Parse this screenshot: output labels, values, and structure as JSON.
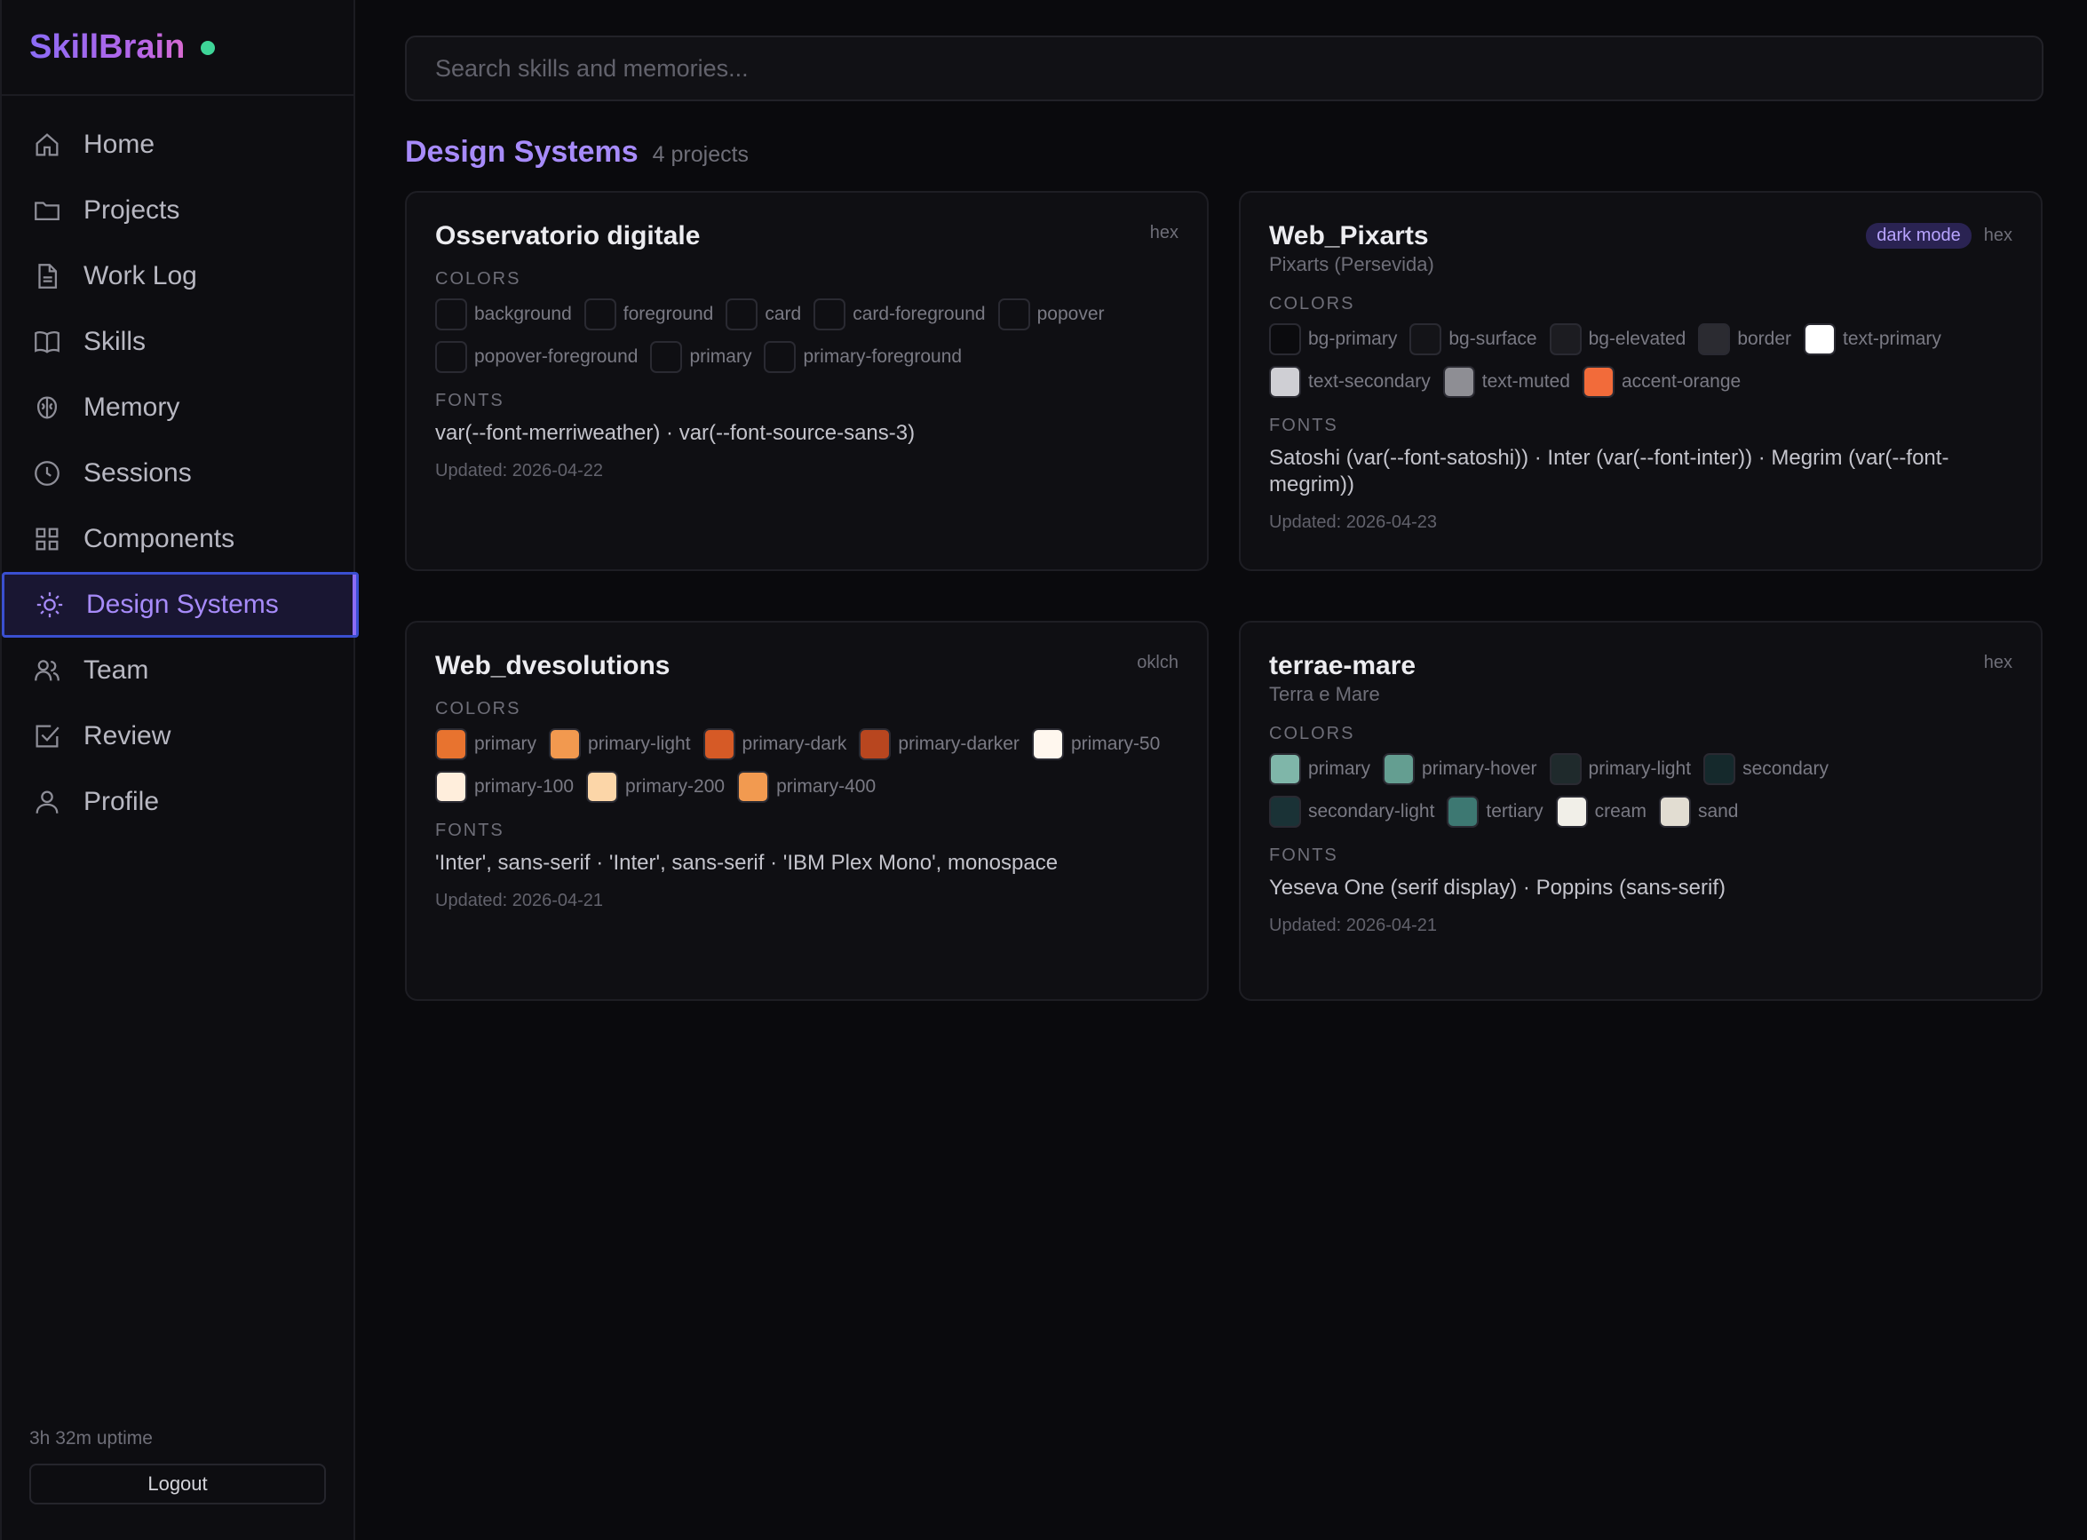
{
  "app": {
    "name": "SkillBrain"
  },
  "sidebar": {
    "items": [
      {
        "label": "Home",
        "icon": "home-icon"
      },
      {
        "label": "Projects",
        "icon": "folder-icon"
      },
      {
        "label": "Work Log",
        "icon": "document-icon"
      },
      {
        "label": "Skills",
        "icon": "book-icon"
      },
      {
        "label": "Memory",
        "icon": "brain-icon"
      },
      {
        "label": "Sessions",
        "icon": "clock-icon"
      },
      {
        "label": "Components",
        "icon": "grid-icon"
      },
      {
        "label": "Design Systems",
        "icon": "sun-icon",
        "active": true
      },
      {
        "label": "Team",
        "icon": "users-icon"
      },
      {
        "label": "Review",
        "icon": "check-square-icon"
      },
      {
        "label": "Profile",
        "icon": "user-icon"
      }
    ],
    "uptime": "3h 32m uptime",
    "logout_label": "Logout"
  },
  "search": {
    "placeholder": "Search skills and memories..."
  },
  "page": {
    "title": "Design Systems",
    "count": "4 projects"
  },
  "labels": {
    "colors": "COLORS",
    "fonts": "FONTS"
  },
  "cards": [
    {
      "title": "Osservatorio digitale",
      "subtitle": "",
      "dark_mode": "",
      "format": "hex",
      "colors": [
        {
          "name": "background",
          "hex": "#0f0f13"
        },
        {
          "name": "foreground",
          "hex": "#0f0f13"
        },
        {
          "name": "card",
          "hex": "#0f0f13"
        },
        {
          "name": "card-foreground",
          "hex": "#0f0f13"
        },
        {
          "name": "popover",
          "hex": "#0f0f13"
        },
        {
          "name": "popover-foreground",
          "hex": "#0f0f13"
        },
        {
          "name": "primary",
          "hex": "#0f0f13"
        },
        {
          "name": "primary-foreground",
          "hex": "#0f0f13"
        }
      ],
      "fonts": "var(--font-merriweather) · var(--font-source-sans-3)",
      "updated": "Updated: 2026-04-22"
    },
    {
      "title": "Web_Pixarts",
      "subtitle": "Pixarts (Persevida)",
      "dark_mode": "dark mode",
      "format": "hex",
      "colors": [
        {
          "name": "bg-primary",
          "hex": "#0b0b0e"
        },
        {
          "name": "bg-surface",
          "hex": "#141418"
        },
        {
          "name": "bg-elevated",
          "hex": "#1c1c21"
        },
        {
          "name": "border",
          "hex": "#2b2b31"
        },
        {
          "name": "text-primary",
          "hex": "#ffffff"
        },
        {
          "name": "text-secondary",
          "hex": "#cfcfd4"
        },
        {
          "name": "text-muted",
          "hex": "#8e8e94"
        },
        {
          "name": "accent-orange",
          "hex": "#f26b3a"
        }
      ],
      "fonts": "Satoshi (var(--font-satoshi)) · Inter (var(--font-inter)) · Megrim (var(--font-megrim))",
      "updated": "Updated: 2026-04-23"
    },
    {
      "title": "Web_dvesolutions",
      "subtitle": "",
      "dark_mode": "",
      "format": "oklch",
      "colors": [
        {
          "name": "primary",
          "hex": "#e8732f"
        },
        {
          "name": "primary-light",
          "hex": "#f2994f"
        },
        {
          "name": "primary-dark",
          "hex": "#d65a26"
        },
        {
          "name": "primary-darker",
          "hex": "#b8461f"
        },
        {
          "name": "primary-50",
          "hex": "#fff7ee"
        },
        {
          "name": "primary-100",
          "hex": "#ffeedc"
        },
        {
          "name": "primary-200",
          "hex": "#fcd6a8"
        },
        {
          "name": "primary-400",
          "hex": "#f29a50"
        }
      ],
      "fonts": "'Inter', sans-serif · 'Inter', sans-serif · 'IBM Plex Mono', monospace",
      "updated": "Updated: 2026-04-21"
    },
    {
      "title": "terrae-mare",
      "subtitle": "Terra e Mare",
      "dark_mode": "",
      "format": "hex",
      "colors": [
        {
          "name": "primary",
          "hex": "#7fb6a9"
        },
        {
          "name": "primary-hover",
          "hex": "#649e91"
        },
        {
          "name": "primary-light",
          "hex": "#1f2a2c"
        },
        {
          "name": "secondary",
          "hex": "#15292c"
        },
        {
          "name": "secondary-light",
          "hex": "#1a3236"
        },
        {
          "name": "tertiary",
          "hex": "#3d7872"
        },
        {
          "name": "cream",
          "hex": "#f1efe8"
        },
        {
          "name": "sand",
          "hex": "#e2ddd2"
        }
      ],
      "fonts": "Yeseva One (serif display) · Poppins (sans-serif)",
      "updated": "Updated: 2026-04-21"
    }
  ]
}
